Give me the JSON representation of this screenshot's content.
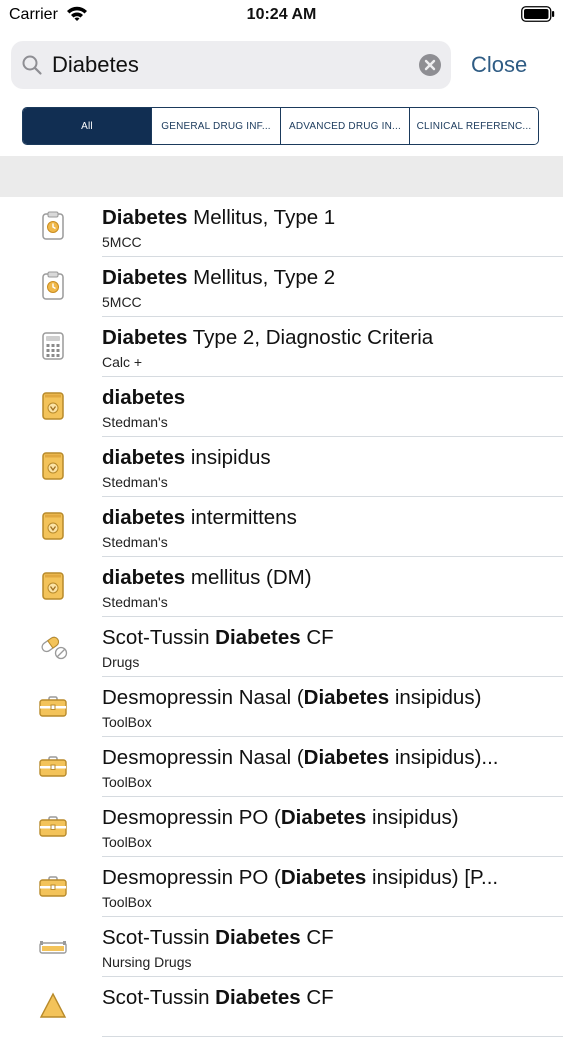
{
  "status_bar": {
    "carrier": "Carrier",
    "time": "10:24 AM"
  },
  "search": {
    "query": "Diabetes",
    "close_label": "Close"
  },
  "segments": [
    "All",
    "GENERAL DRUG INF...",
    "ADVANCED DRUG IN...",
    "CLINICAL REFERENC..."
  ],
  "results": [
    {
      "icon": "clipboard-icon",
      "pre": "",
      "bold": "Diabetes",
      "post": " Mellitus, Type 1",
      "source": "5MCC"
    },
    {
      "icon": "clipboard-icon",
      "pre": "",
      "bold": "Diabetes",
      "post": " Mellitus, Type 2",
      "source": "5MCC"
    },
    {
      "icon": "calculator-icon",
      "pre": "",
      "bold": "Diabetes",
      "post": " Type 2, Diagnostic Criteria",
      "source": "Calc +"
    },
    {
      "icon": "dictionary-icon",
      "pre": "",
      "bold": "diabetes",
      "post": "",
      "source": "Stedman's"
    },
    {
      "icon": "dictionary-icon",
      "pre": "",
      "bold": "diabetes",
      "post": " insipidus",
      "source": "Stedman's"
    },
    {
      "icon": "dictionary-icon",
      "pre": "",
      "bold": "diabetes",
      "post": " intermittens",
      "source": "Stedman's"
    },
    {
      "icon": "dictionary-icon",
      "pre": "",
      "bold": "diabetes",
      "post": " mellitus (DM)",
      "source": "Stedman's"
    },
    {
      "icon": "pill-icon",
      "pre": "Scot-Tussin ",
      "bold": "Diabetes",
      "post": " CF",
      "source": "Drugs"
    },
    {
      "icon": "toolbox-icon",
      "pre": "Desmopressin Nasal (",
      "bold": "Diabetes",
      "post": " insipidus)",
      "source": "ToolBox"
    },
    {
      "icon": "toolbox-icon",
      "pre": "Desmopressin Nasal (",
      "bold": "Diabetes",
      "post": " insipidus)...",
      "source": "ToolBox"
    },
    {
      "icon": "toolbox-icon",
      "pre": "Desmopressin PO (",
      "bold": "Diabetes",
      "post": " insipidus)",
      "source": "ToolBox"
    },
    {
      "icon": "toolbox-icon",
      "pre": "Desmopressin PO (",
      "bold": "Diabetes",
      "post": " insipidus) [P...",
      "source": "ToolBox"
    },
    {
      "icon": "nursing-drugs-icon",
      "pre": "Scot-Tussin ",
      "bold": "Diabetes",
      "post": " CF",
      "source": "Nursing Drugs"
    },
    {
      "icon": "warning-icon",
      "pre": "Scot-Tussin ",
      "bold": "Diabetes",
      "post": " CF",
      "source": ""
    }
  ]
}
